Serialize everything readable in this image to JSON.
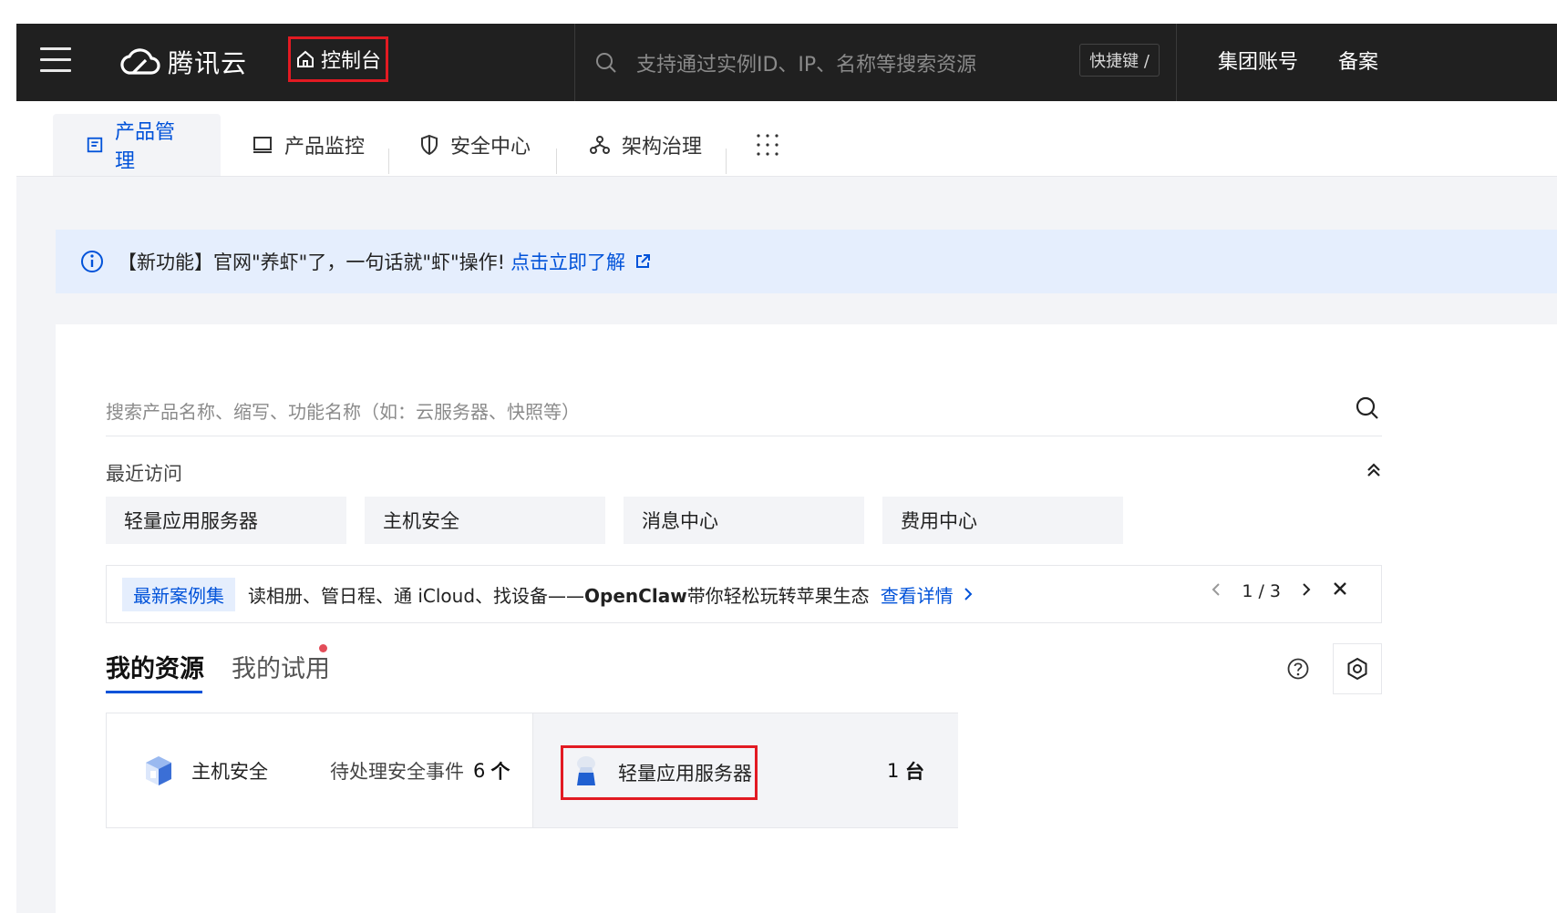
{
  "brand": {
    "name": "腾讯云"
  },
  "topbar": {
    "console_label": "控制台",
    "search_placeholder": "支持通过实例ID、IP、名称等搜索资源",
    "shortcut_label": "快捷键 /",
    "group_account_label": "集团账号",
    "filing_label": "备案"
  },
  "tabs": [
    {
      "label": "产品管理",
      "active": true,
      "icon": "document-icon"
    },
    {
      "label": "产品监控",
      "active": false,
      "icon": "monitor-icon"
    },
    {
      "label": "安全中心",
      "active": false,
      "icon": "shield-icon"
    },
    {
      "label": "架构治理",
      "active": false,
      "icon": "architecture-icon"
    }
  ],
  "notice": {
    "text": "【新功能】官网\"养虾\"了，一句话就\"虾\"操作!",
    "link_label": "点击立即了解"
  },
  "product_search": {
    "placeholder": "搜索产品名称、缩写、功能名称（如：云服务器、快照等）"
  },
  "recent": {
    "title": "最近访问",
    "items": [
      "轻量应用服务器",
      "主机安全",
      "消息中心",
      "费用中心"
    ]
  },
  "case_banner": {
    "badge": "最新案例集",
    "text_prefix": "读相册、管日程、通 iCloud、找设备——",
    "text_bold": "OpenClaw",
    "text_suffix": "带你轻松玩转苹果生态",
    "link_label": "查看详情",
    "page_indicator": "1 / 3"
  },
  "resources": {
    "tab_mine": "我的资源",
    "tab_trial": "我的试用",
    "items": [
      {
        "name": "主机安全",
        "meta_label": "待处理安全事件",
        "count": "6",
        "unit": "个"
      },
      {
        "name": "轻量应用服务器",
        "count": "1",
        "unit": "台"
      }
    ]
  },
  "colors": {
    "accent": "#0052d9",
    "highlight_red": "#e21a22",
    "topbar_bg": "#202020"
  }
}
